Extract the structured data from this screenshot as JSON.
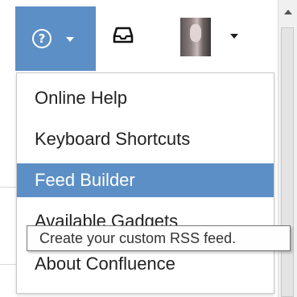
{
  "header": {
    "help_button_icon": "question-circle-icon",
    "inbox_icon": "inbox-tray-icon",
    "avatar_icon": "user-avatar-photo"
  },
  "menu": {
    "items": [
      {
        "label": "Online Help",
        "active": false
      },
      {
        "label": "Keyboard Shortcuts",
        "active": false
      },
      {
        "label": "Feed Builder",
        "active": true
      },
      {
        "label": "Available Gadgets",
        "active": false
      },
      {
        "label": "About Confluence",
        "active": false
      }
    ]
  },
  "tooltip": {
    "text": "Create your custom RSS feed."
  },
  "colors": {
    "accent": "#5c8fc5",
    "menu_text": "#222222",
    "tooltip_border": "#767676"
  }
}
